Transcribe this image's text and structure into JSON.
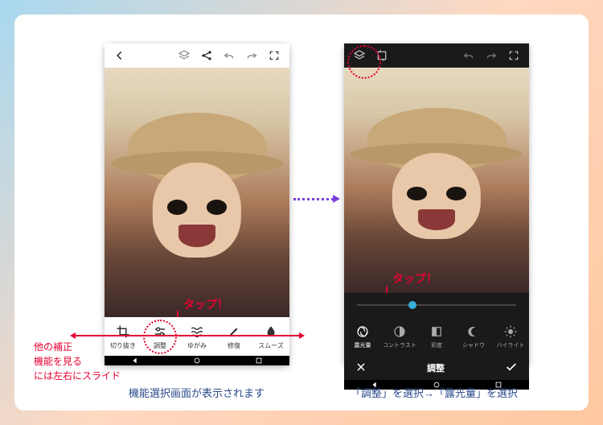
{
  "phone1": {
    "tap_label": "タップ！",
    "tools": [
      {
        "label": "切り抜き",
        "icon": "crop"
      },
      {
        "label": "調整",
        "icon": "adjust"
      },
      {
        "label": "ゆがみ",
        "icon": "waves"
      },
      {
        "label": "修復",
        "icon": "brush"
      },
      {
        "label": "スムーズ",
        "icon": "drop"
      }
    ]
  },
  "phone2": {
    "tap_label": "タップ！",
    "title": "調整",
    "tools": [
      {
        "label": "露光量",
        "icon": "aperture"
      },
      {
        "label": "コントラスト",
        "icon": "contrast"
      },
      {
        "label": "彩度",
        "icon": "saturation"
      },
      {
        "label": "シャドウ",
        "icon": "shadow"
      },
      {
        "label": "ハイライト",
        "icon": "highlight"
      }
    ]
  },
  "side_note": {
    "line1": "他の補正",
    "line2": "機能を見る",
    "line3": "には左右にスライド"
  },
  "caption1": "機能選択画面が表示されます",
  "caption2": "「調整」を選択→「露光量」を選択"
}
